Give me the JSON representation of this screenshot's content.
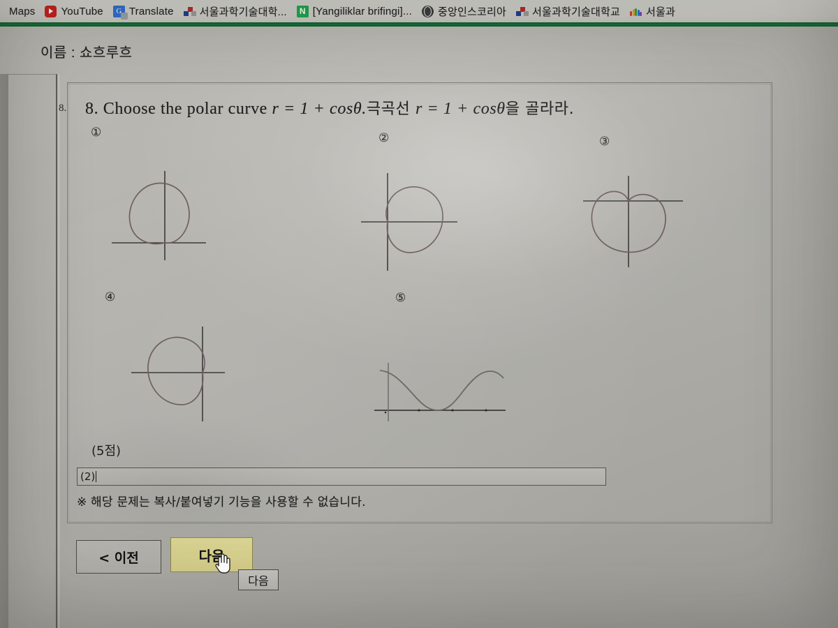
{
  "browser": {
    "bookmarks": [
      {
        "label": "Maps",
        "icon": "maps-icon"
      },
      {
        "label": "YouTube",
        "icon": "youtube-icon"
      },
      {
        "label": "Translate",
        "icon": "google-translate-icon"
      },
      {
        "label": "서울과학기술대학...",
        "icon": "seoultech-icon"
      },
      {
        "label": "[Yangiliklar brifingi]...",
        "icon": "naver-icon"
      },
      {
        "label": "중앙인스코리아",
        "icon": "globe-icon"
      },
      {
        "label": "서울과학기술대학교",
        "icon": "seoultech-icon"
      },
      {
        "label": "서울과",
        "icon": "colorful-hand-icon"
      }
    ]
  },
  "exam": {
    "name_label": "이름 : 쇼흐루흐",
    "question_index": "8.",
    "question_text_en": "8. Choose the polar curve ",
    "question_formula_en": "r = 1 + cosθ.",
    "question_text_ko_prefix": "극곡선 ",
    "question_formula_ko": "r = 1 + cosθ",
    "question_text_ko_suffix": "을 골라라.",
    "score_label": "(5점)",
    "answer_value": "(2)",
    "answer_placeholder": "",
    "notice": "※ 해당 문제는 복사/붙여넣기 기능을 사용할 수 없습니다.",
    "options": [
      {
        "num": "①",
        "desc": "cardioid-cusp-down"
      },
      {
        "num": "②",
        "desc": "cardioid-cusp-left"
      },
      {
        "num": "③",
        "desc": "cardioid-cusp-up"
      },
      {
        "num": "④",
        "desc": "cardioid-cusp-right"
      },
      {
        "num": "⑤",
        "desc": "cartesian-cosine-wave"
      }
    ]
  },
  "nav": {
    "prev_label": "< 이전",
    "next_label": "다음",
    "tooltip_label": "다음"
  },
  "chart_data": [
    {
      "type": "line",
      "id": "option-1-figure",
      "title": "①",
      "curve": "cardioid r = 1 - sinθ (cusp at origin pointing down, lobe upward)",
      "axes": {
        "x_axis": true,
        "y_axis": true
      },
      "notes": "cusp at origin on horizontal axis, body above axis"
    },
    {
      "type": "line",
      "id": "option-2-figure",
      "title": "②",
      "curve": "cardioid r = 1 + cosθ (cusp at origin pointing left, lobe to the right)",
      "axes": {
        "x_axis": true,
        "y_axis": true
      },
      "notes": "correct answer: cusp on left at origin, max extent +2 along positive x"
    },
    {
      "type": "line",
      "id": "option-3-figure",
      "title": "③",
      "curve": "cardioid r = 1 + sinθ reflected (cusp at origin pointing up, lobe downward)",
      "axes": {
        "x_axis": true,
        "y_axis": true
      },
      "notes": "cusp at origin on horizontal axis, body below axis"
    },
    {
      "type": "line",
      "id": "option-4-figure",
      "title": "④",
      "curve": "cardioid r = 1 - cosθ (cusp at origin pointing right, lobe to the left)",
      "axes": {
        "x_axis": true,
        "y_axis": true
      },
      "notes": "cusp on right at origin, max extent -2 along negative x"
    },
    {
      "type": "line",
      "id": "option-5-figure",
      "title": "⑤",
      "curve": "cartesian y = 1 + cos(x)",
      "x": [
        0,
        1.57,
        3.14,
        4.71,
        6.28
      ],
      "values": [
        2,
        1,
        0,
        1,
        2
      ],
      "xlim": [
        0,
        6.9
      ],
      "ylim": [
        0,
        2.2
      ],
      "axes": {
        "x_axis": true,
        "y_axis": true
      },
      "notes": "cosine wave touching zero at x = pi, ticks on x axis"
    }
  ]
}
